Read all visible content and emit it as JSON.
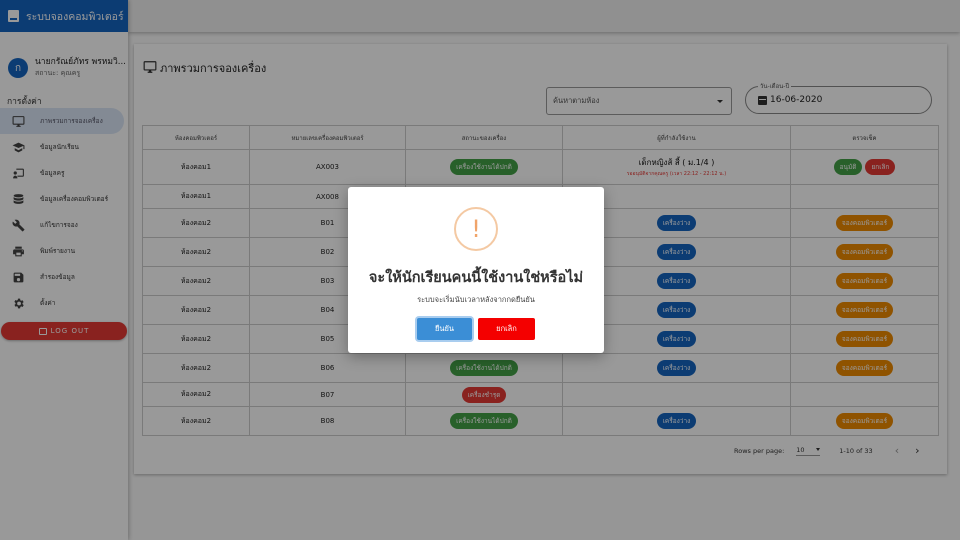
{
  "app": {
    "title": "ระบบจองคอมพิวเตอร์"
  },
  "user": {
    "initial": "ก",
    "name": "นายกรัณย์ภัทร พรหมวิ...",
    "status": "สถานะ: คุณครู"
  },
  "sidebar": {
    "section_label": "การตั้งค่า",
    "items": [
      {
        "label": "ภาพรวมการจองเครื่อง",
        "icon": "monitor-icon"
      },
      {
        "label": "ข้อมูลนักเรียน",
        "icon": "student-icon"
      },
      {
        "label": "ข้อมูลครู",
        "icon": "teacher-icon"
      },
      {
        "label": "ข้อมูลเครื่องคอมพิวเตอร์",
        "icon": "database-icon"
      },
      {
        "label": "แก้ไขการจอง",
        "icon": "wrench-icon"
      },
      {
        "label": "พิมพ์รายงาน",
        "icon": "printer-icon"
      },
      {
        "label": "สำรองข้อมูล",
        "icon": "save-icon"
      },
      {
        "label": "ตั้งค่า",
        "icon": "gear-icon"
      }
    ],
    "logout_label": "LOG OUT"
  },
  "main": {
    "title": "ภาพรวมการจองเครื่อง",
    "room_select": {
      "placeholder": "ค้นหาตามห้อง"
    },
    "date": {
      "label": "วัน-เดือน-ปี",
      "value": "16-06-2020"
    },
    "table": {
      "headers": [
        "ห้องคอมพิวเตอร์",
        "หมายเลขเครื่องคอมพิวเตอร์",
        "สถานะของเครื่อง",
        "ผู้ที่กำลังใช้งาน",
        "ตรวจเช็ค"
      ],
      "rows": [
        {
          "room": "ห้องคอม1",
          "no": "AX003",
          "status": "เครื่องใช้งานได้ปกติ",
          "status_color": "green",
          "user_name": "เด็กหญิงส้ สี้ ( ม.1/4 )",
          "user_note": "รออนุมัติจากคุณครู (เวลา 22:12 - 22:12 น.)",
          "check": [
            "อนุมัติ",
            "ยกเลิก"
          ]
        },
        {
          "room": "ห้องคอม1",
          "no": "AX008",
          "status": "",
          "status_color": "",
          "user_pill": "",
          "check_pill": ""
        },
        {
          "room": "ห้องคอม2",
          "no": "B01",
          "status": "",
          "status_color": "",
          "user_pill": "เครื่องว่าง",
          "check_pill": "จองคอมพิวเตอร์"
        },
        {
          "room": "ห้องคอม2",
          "no": "B02",
          "status": "",
          "status_color": "",
          "user_pill": "เครื่องว่าง",
          "check_pill": "จองคอมพิวเตอร์"
        },
        {
          "room": "ห้องคอม2",
          "no": "B03",
          "status": "",
          "status_color": "",
          "user_pill": "เครื่องว่าง",
          "check_pill": "จองคอมพิวเตอร์"
        },
        {
          "room": "ห้องคอม2",
          "no": "B04",
          "status": "",
          "status_color": "",
          "user_pill": "เครื่องว่าง",
          "check_pill": "จองคอมพิวเตอร์"
        },
        {
          "room": "ห้องคอม2",
          "no": "B05",
          "status": "",
          "status_color": "",
          "user_pill": "เครื่องว่าง",
          "check_pill": "จองคอมพิวเตอร์"
        },
        {
          "room": "ห้องคอม2",
          "no": "B06",
          "status": "เครื่องใช้งานได้ปกติ",
          "status_color": "green",
          "user_pill": "เครื่องว่าง",
          "check_pill": "จองคอมพิวเตอร์"
        },
        {
          "room": "ห้องคอม2",
          "no": "B07",
          "status": "เครื่องชำรุด",
          "status_color": "red",
          "user_pill": "",
          "check_pill": ""
        },
        {
          "room": "ห้องคอม2",
          "no": "B08",
          "status": "เครื่องใช้งานได้ปกติ",
          "status_color": "green",
          "user_pill": "เครื่องว่าง",
          "check_pill": "จองคอมพิวเตอร์"
        }
      ]
    },
    "pager": {
      "rows_per_page_label": "Rows per page:",
      "rows_per_page": "10",
      "range": "1-10 of 33",
      "prev": "‹",
      "next": "›"
    }
  },
  "dialog": {
    "icon": "!",
    "title": "จะให้นักเรียนคนนี้ใช้งานใช่หรือไม่",
    "text": "ระบบจะเริ่มนับเวลาหลังจากกดยืนยัน",
    "confirm_label": "ยืนยัน",
    "cancel_label": "ยกเลิก"
  },
  "colors": {
    "primary": "#1565c0",
    "success": "#43a047",
    "danger": "#e53935",
    "warning": "#ef8a00"
  }
}
